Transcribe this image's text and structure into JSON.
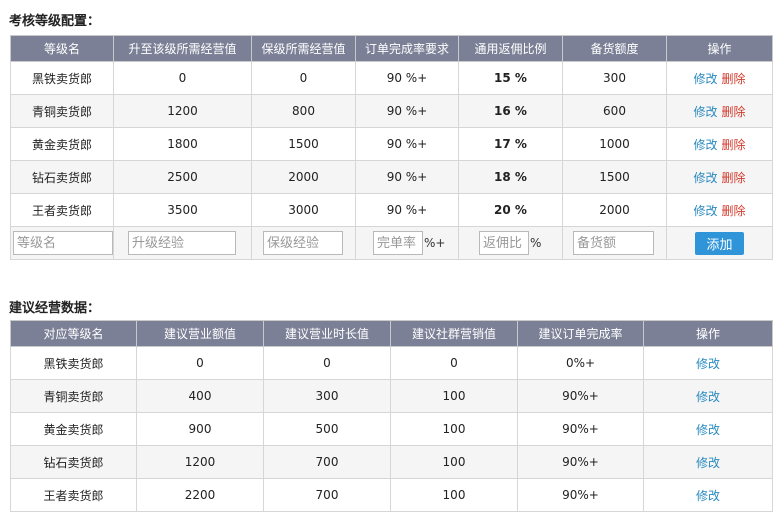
{
  "section1": {
    "title": "考核等级配置：",
    "headers": [
      "等级名",
      "升至该级所需经营值",
      "保级所需经营值",
      "订单完成率要求",
      "通用返佣比例",
      "备货额度",
      "操作"
    ],
    "rows": [
      {
        "name": "黑铁卖货郎",
        "upgrade": "0",
        "keep": "0",
        "completion": "90 %+",
        "rebate": "15 %",
        "stock": "300"
      },
      {
        "name": "青铜卖货郎",
        "upgrade": "1200",
        "keep": "800",
        "completion": "90 %+",
        "rebate": "16 %",
        "stock": "600"
      },
      {
        "name": "黄金卖货郎",
        "upgrade": "1800",
        "keep": "1500",
        "completion": "90 %+",
        "rebate": "17 %",
        "stock": "1000"
      },
      {
        "name": "钻石卖货郎",
        "upgrade": "2500",
        "keep": "2000",
        "completion": "90 %+",
        "rebate": "18 %",
        "stock": "1500"
      },
      {
        "name": "王者卖货郎",
        "upgrade": "3500",
        "keep": "3000",
        "completion": "90 %+",
        "rebate": "20 %",
        "stock": "2000"
      }
    ],
    "edit_label": "修改",
    "delete_label": "删除",
    "inputs": {
      "name_placeholder": "等级名",
      "upgrade_placeholder": "升级经验",
      "keep_placeholder": "保级经验",
      "completion_placeholder": "完单率",
      "completion_suffix": "%+",
      "rebate_placeholder": "返佣比",
      "rebate_suffix": "%",
      "stock_placeholder": "备货额"
    },
    "add_label": "添加"
  },
  "section2": {
    "title": "建议经营数据：",
    "headers": [
      "对应等级名",
      "建议营业额值",
      "建议营业时长值",
      "建议社群营销值",
      "建议订单完成率",
      "操作"
    ],
    "rows": [
      {
        "name": "黑铁卖货郎",
        "revenue": "0",
        "hours": "0",
        "community": "0",
        "completion": "0%+"
      },
      {
        "name": "青铜卖货郎",
        "revenue": "400",
        "hours": "300",
        "community": "100",
        "completion": "90%+"
      },
      {
        "name": "黄金卖货郎",
        "revenue": "900",
        "hours": "500",
        "community": "100",
        "completion": "90%+"
      },
      {
        "name": "钻石卖货郎",
        "revenue": "1200",
        "hours": "700",
        "community": "100",
        "completion": "90%+"
      },
      {
        "name": "王者卖货郎",
        "revenue": "2200",
        "hours": "700",
        "community": "100",
        "completion": "90%+"
      }
    ],
    "edit_label": "修改"
  }
}
